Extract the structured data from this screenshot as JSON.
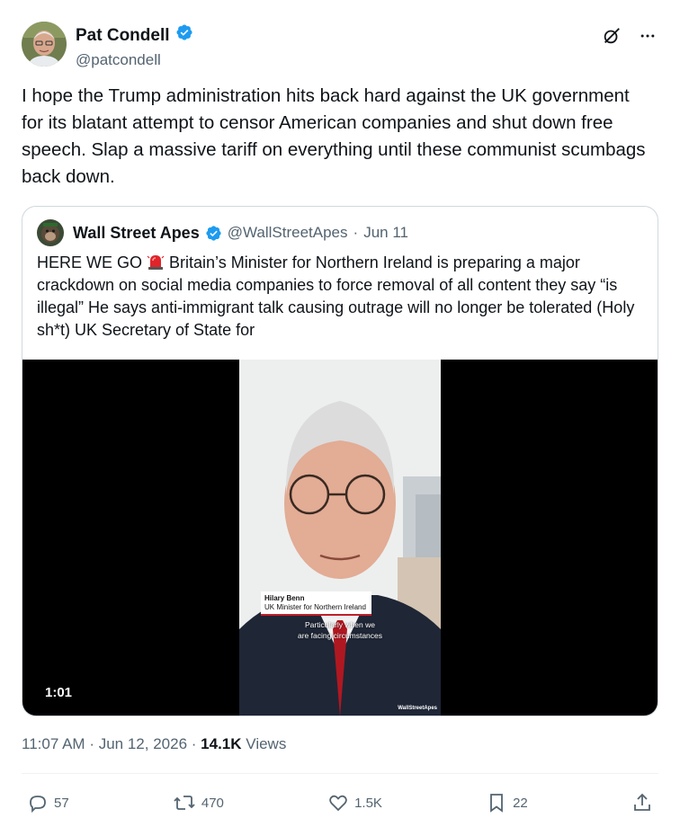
{
  "author": {
    "display_name": "Pat Condell",
    "handle": "@patcondell",
    "verified": true,
    "avatar_icon": "profile-photo"
  },
  "tweet": {
    "text": "I hope the Trump administration hits back hard against the UK government for its blatant attempt to censor American companies and shut down free speech. Slap a massive tariff on everything until these communist scumbags back down."
  },
  "quote": {
    "display_name": "Wall Street Apes",
    "handle": "@WallStreetApes",
    "separator": "·",
    "date": "Jun 11",
    "text_before_emoji": "HERE WE GO ",
    "emoji_icon": "rotating-light-icon",
    "text_after_emoji": " Britain’s Minister for Northern Ireland is preparing a major crackdown on social media companies to force removal of all content they say “is illegal” He says anti-immigrant talk causing outrage will no longer be tolerated (Holy sh*t) UK Secretary of State for",
    "video": {
      "duration": "1:01",
      "lower_third_name": "Hilary Benn",
      "lower_third_title": "UK Minister for Northern Ireland",
      "caption_line1": "Particularly when we",
      "caption_line2": "are facing circumstances",
      "watermark": "WallStreetApes"
    }
  },
  "meta": {
    "time": "11:07 AM",
    "separator": "·",
    "date": "Jun 12, 2026",
    "separator2": "·",
    "views_count": "14.1K",
    "views_label": "Views"
  },
  "actions": {
    "replies": "57",
    "reposts": "470",
    "likes": "1.5K",
    "bookmarks": "22"
  },
  "colors": {
    "verified": "#1d9bf0",
    "secondary_text": "#536471",
    "border": "#cfd9de"
  }
}
